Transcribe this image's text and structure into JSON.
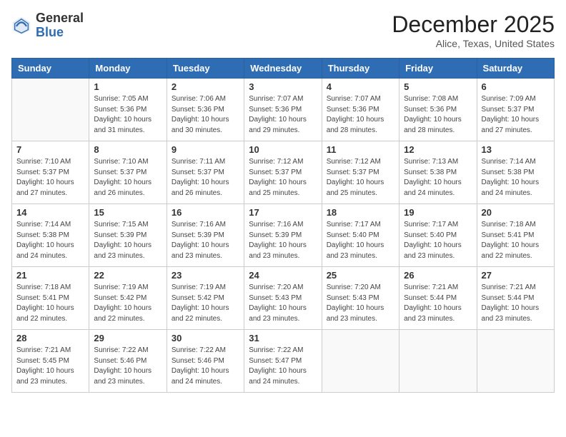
{
  "header": {
    "logo_general": "General",
    "logo_blue": "Blue",
    "title": "December 2025",
    "subtitle": "Alice, Texas, United States"
  },
  "days_of_week": [
    "Sunday",
    "Monday",
    "Tuesday",
    "Wednesday",
    "Thursday",
    "Friday",
    "Saturday"
  ],
  "weeks": [
    [
      {
        "day": "",
        "info": ""
      },
      {
        "day": "1",
        "info": "Sunrise: 7:05 AM\nSunset: 5:36 PM\nDaylight: 10 hours\nand 31 minutes."
      },
      {
        "day": "2",
        "info": "Sunrise: 7:06 AM\nSunset: 5:36 PM\nDaylight: 10 hours\nand 30 minutes."
      },
      {
        "day": "3",
        "info": "Sunrise: 7:07 AM\nSunset: 5:36 PM\nDaylight: 10 hours\nand 29 minutes."
      },
      {
        "day": "4",
        "info": "Sunrise: 7:07 AM\nSunset: 5:36 PM\nDaylight: 10 hours\nand 28 minutes."
      },
      {
        "day": "5",
        "info": "Sunrise: 7:08 AM\nSunset: 5:36 PM\nDaylight: 10 hours\nand 28 minutes."
      },
      {
        "day": "6",
        "info": "Sunrise: 7:09 AM\nSunset: 5:37 PM\nDaylight: 10 hours\nand 27 minutes."
      }
    ],
    [
      {
        "day": "7",
        "info": "Sunrise: 7:10 AM\nSunset: 5:37 PM\nDaylight: 10 hours\nand 27 minutes."
      },
      {
        "day": "8",
        "info": "Sunrise: 7:10 AM\nSunset: 5:37 PM\nDaylight: 10 hours\nand 26 minutes."
      },
      {
        "day": "9",
        "info": "Sunrise: 7:11 AM\nSunset: 5:37 PM\nDaylight: 10 hours\nand 26 minutes."
      },
      {
        "day": "10",
        "info": "Sunrise: 7:12 AM\nSunset: 5:37 PM\nDaylight: 10 hours\nand 25 minutes."
      },
      {
        "day": "11",
        "info": "Sunrise: 7:12 AM\nSunset: 5:37 PM\nDaylight: 10 hours\nand 25 minutes."
      },
      {
        "day": "12",
        "info": "Sunrise: 7:13 AM\nSunset: 5:38 PM\nDaylight: 10 hours\nand 24 minutes."
      },
      {
        "day": "13",
        "info": "Sunrise: 7:14 AM\nSunset: 5:38 PM\nDaylight: 10 hours\nand 24 minutes."
      }
    ],
    [
      {
        "day": "14",
        "info": "Sunrise: 7:14 AM\nSunset: 5:38 PM\nDaylight: 10 hours\nand 24 minutes."
      },
      {
        "day": "15",
        "info": "Sunrise: 7:15 AM\nSunset: 5:39 PM\nDaylight: 10 hours\nand 23 minutes."
      },
      {
        "day": "16",
        "info": "Sunrise: 7:16 AM\nSunset: 5:39 PM\nDaylight: 10 hours\nand 23 minutes."
      },
      {
        "day": "17",
        "info": "Sunrise: 7:16 AM\nSunset: 5:39 PM\nDaylight: 10 hours\nand 23 minutes."
      },
      {
        "day": "18",
        "info": "Sunrise: 7:17 AM\nSunset: 5:40 PM\nDaylight: 10 hours\nand 23 minutes."
      },
      {
        "day": "19",
        "info": "Sunrise: 7:17 AM\nSunset: 5:40 PM\nDaylight: 10 hours\nand 23 minutes."
      },
      {
        "day": "20",
        "info": "Sunrise: 7:18 AM\nSunset: 5:41 PM\nDaylight: 10 hours\nand 22 minutes."
      }
    ],
    [
      {
        "day": "21",
        "info": "Sunrise: 7:18 AM\nSunset: 5:41 PM\nDaylight: 10 hours\nand 22 minutes."
      },
      {
        "day": "22",
        "info": "Sunrise: 7:19 AM\nSunset: 5:42 PM\nDaylight: 10 hours\nand 22 minutes."
      },
      {
        "day": "23",
        "info": "Sunrise: 7:19 AM\nSunset: 5:42 PM\nDaylight: 10 hours\nand 22 minutes."
      },
      {
        "day": "24",
        "info": "Sunrise: 7:20 AM\nSunset: 5:43 PM\nDaylight: 10 hours\nand 23 minutes."
      },
      {
        "day": "25",
        "info": "Sunrise: 7:20 AM\nSunset: 5:43 PM\nDaylight: 10 hours\nand 23 minutes."
      },
      {
        "day": "26",
        "info": "Sunrise: 7:21 AM\nSunset: 5:44 PM\nDaylight: 10 hours\nand 23 minutes."
      },
      {
        "day": "27",
        "info": "Sunrise: 7:21 AM\nSunset: 5:44 PM\nDaylight: 10 hours\nand 23 minutes."
      }
    ],
    [
      {
        "day": "28",
        "info": "Sunrise: 7:21 AM\nSunset: 5:45 PM\nDaylight: 10 hours\nand 23 minutes."
      },
      {
        "day": "29",
        "info": "Sunrise: 7:22 AM\nSunset: 5:46 PM\nDaylight: 10 hours\nand 23 minutes."
      },
      {
        "day": "30",
        "info": "Sunrise: 7:22 AM\nSunset: 5:46 PM\nDaylight: 10 hours\nand 24 minutes."
      },
      {
        "day": "31",
        "info": "Sunrise: 7:22 AM\nSunset: 5:47 PM\nDaylight: 10 hours\nand 24 minutes."
      },
      {
        "day": "",
        "info": ""
      },
      {
        "day": "",
        "info": ""
      },
      {
        "day": "",
        "info": ""
      }
    ]
  ]
}
